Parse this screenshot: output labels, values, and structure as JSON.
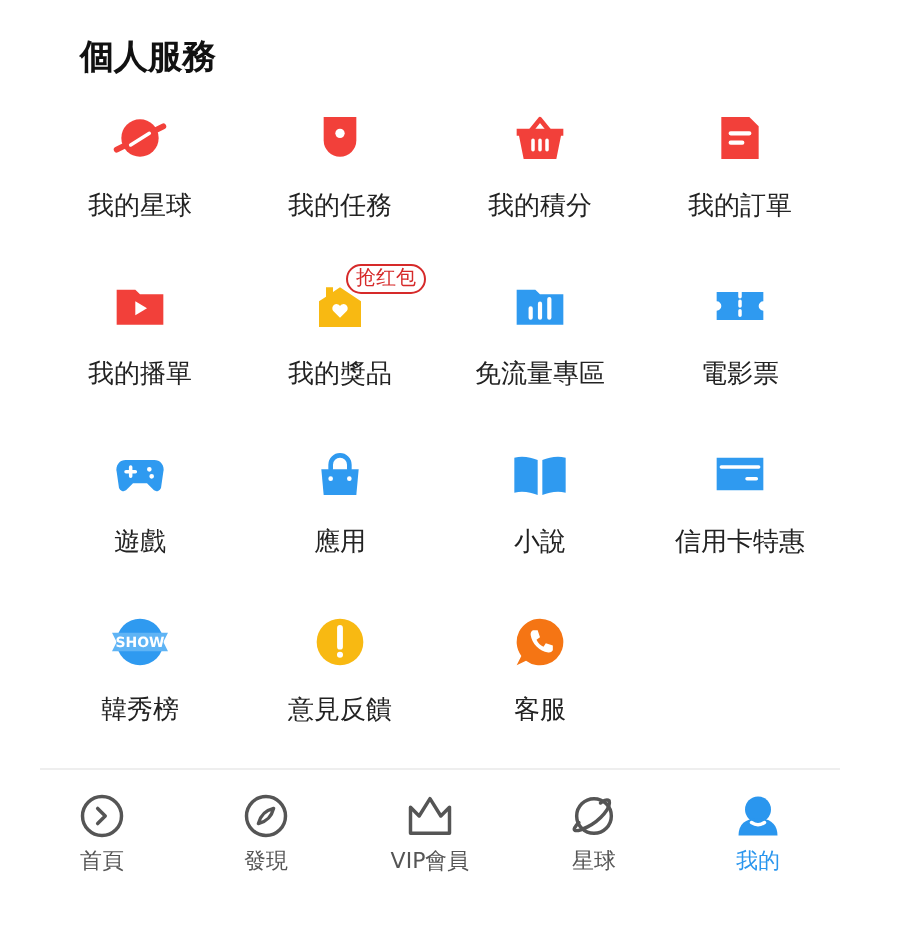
{
  "section_title": "個人服務",
  "services": [
    {
      "label": "我的星球"
    },
    {
      "label": "我的任務"
    },
    {
      "label": "我的積分"
    },
    {
      "label": "我的訂單"
    },
    {
      "label": "我的播單"
    },
    {
      "label": "我的獎品",
      "badge": "抢红包"
    },
    {
      "label": "免流量專區"
    },
    {
      "label": "電影票"
    },
    {
      "label": "遊戲"
    },
    {
      "label": "應用"
    },
    {
      "label": "小說"
    },
    {
      "label": "信用卡特惠"
    },
    {
      "label": "韓秀榜",
      "icon_text": "SHOW"
    },
    {
      "label": "意見反饋"
    },
    {
      "label": "客服"
    }
  ],
  "tab_bar": [
    {
      "label": "首頁",
      "selected": false
    },
    {
      "label": "發現",
      "selected": false
    },
    {
      "label": "VIP會員",
      "selected": false
    },
    {
      "label": "星球",
      "selected": false
    },
    {
      "label": "我的",
      "selected": true
    }
  ]
}
